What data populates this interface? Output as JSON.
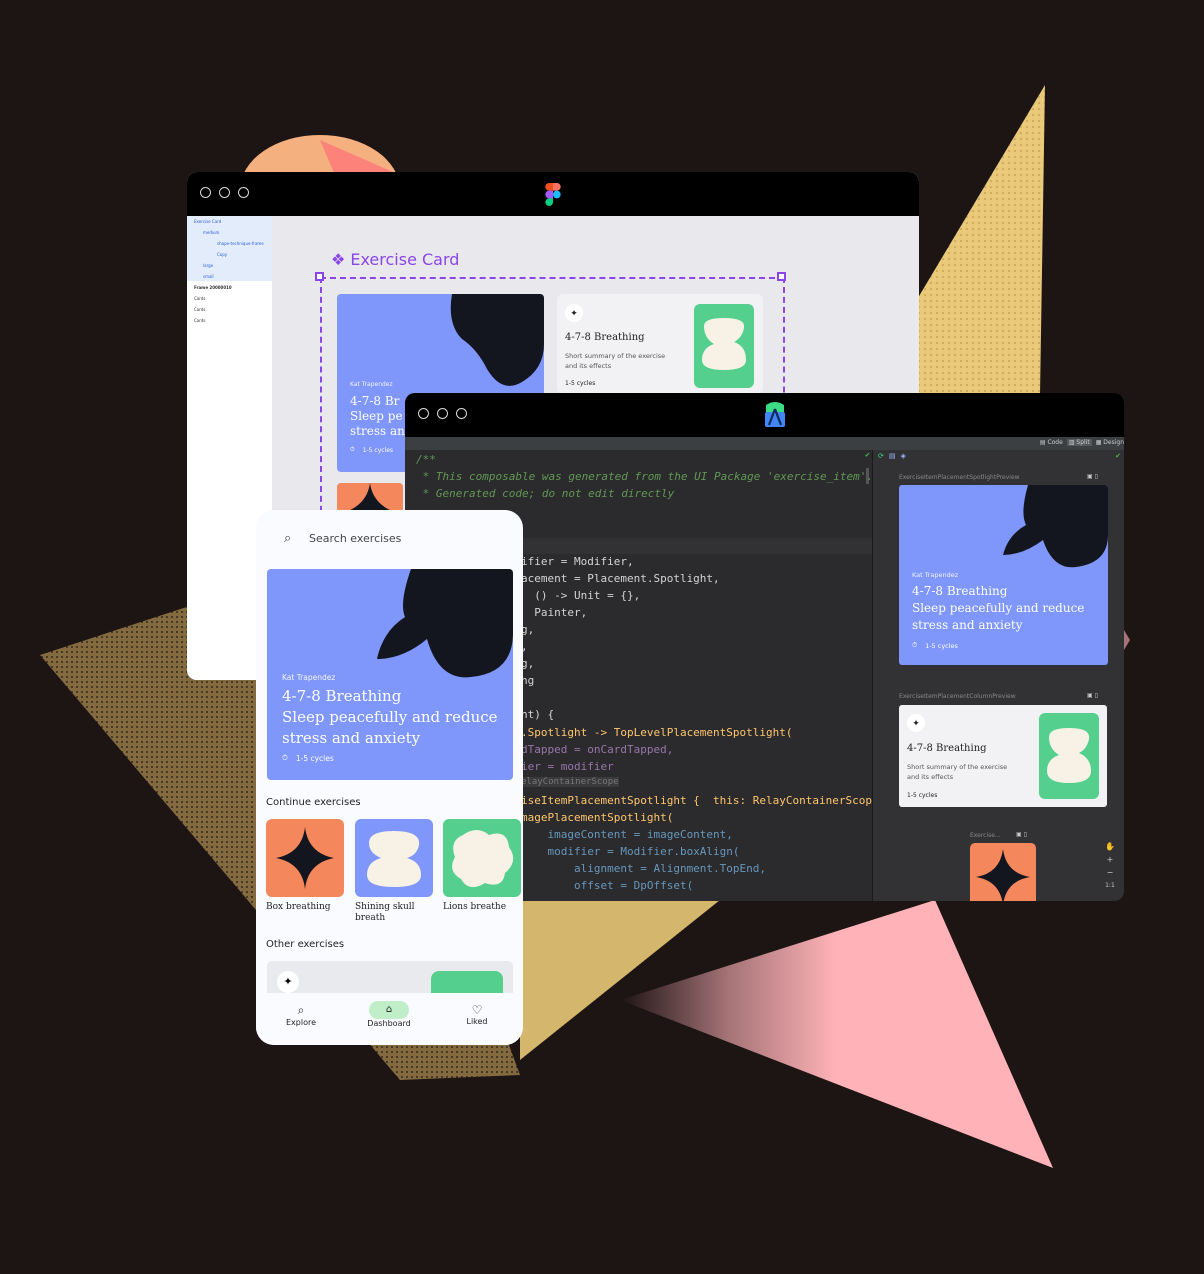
{
  "colors": {
    "background": "#1d1414",
    "figma_accent": "#8a46e6",
    "card_blue": "#7f96fb",
    "card_green": "#55cf8e",
    "card_orange": "#f5875c",
    "blob_dark": "#14161f",
    "shape_cream": "#f7f2e5",
    "triangle_yellow": "#e9c877",
    "triangle_pink": "#ffb3b8"
  },
  "figma": {
    "icon": "figma-logo-icon",
    "layers": [
      "Exercise Card",
      "medium",
      "shape-technique-frame",
      "Copy",
      "large",
      "small",
      "Frame 20000010",
      "Cards",
      "Cards",
      "Cards"
    ],
    "component_title": "Exercise Card",
    "spotlight_card": {
      "author": "Kat Trapendez",
      "title_line1": "4-7-8 Br",
      "title_line2": "Sleep pe",
      "title_line3": "stress an",
      "cycles": "1-5 cycles"
    },
    "column_card": {
      "title": "4-7-8 Breathing",
      "summary_line1": "Short summary of the exercise",
      "summary_line2": "and its effects",
      "cycles": "1-5 cycles"
    }
  },
  "studio": {
    "icon": "android-studio-icon",
    "view_modes": {
      "code": "Code",
      "split": "Split",
      "design": "Design"
    },
    "code_lines": [
      "/**",
      " * This composable was generated from the UI Package 'exercise_item'.",
      " * Generated code; do not edit directly",
      "ifier = Modifier,",
      "acement = Placement.Spotlight,",
      "  () -> Unit = {},",
      "  Painter,",
      "g,",
      ",",
      "g,",
      "ng",
      "nt) {",
      ".Spotlight -> TopLevelPlacementSpotlight(",
      "dTapped = onCardTapped,",
      "ier = modifier",
      "elayContainerScope",
      "iseItemPlacementSpotlight {  this: RelayContainerScope",
      "magePlacementSpotlight(",
      "    imageContent = imageContent,",
      "    modifier = Modifier.boxAlign(",
      "        alignment = Alignment.TopEnd,",
      "        offset = DpOffset("
    ],
    "preview1_label": "ExerciseItemPlacementSpotlightPreview",
    "preview2_label": "ExerciseItemPlacementColumnPreview",
    "preview3_label": "Exercise...",
    "spotlight_card": {
      "author": "Kat Trapendez",
      "title_line1": "4-7-8 Breathing",
      "title_line2": "Sleep peacefully and reduce",
      "title_line3": "stress and anxiety",
      "cycles": "1-5 cycles"
    },
    "column_card": {
      "title": "4-7-8 Breathing",
      "summary_line1": "Short summary of the exercise",
      "summary_line2": "and its effects",
      "cycles": "1-5 cycles"
    },
    "zoom_ratio": "1:1"
  },
  "phone": {
    "search_placeholder": "Search exercises",
    "spotlight_card": {
      "author": "Kat Trapendez",
      "title_line1": "4-7-8 Breathing",
      "title_line2": "Sleep peacefully and reduce",
      "title_line3": "stress and anxiety",
      "cycles": "1-5 cycles"
    },
    "continue_heading": "Continue exercises",
    "continue_items": [
      {
        "label_line1": "Box breathing",
        "label_line2": ""
      },
      {
        "label_line1": "Shining skull",
        "label_line2": "breath"
      },
      {
        "label_line1": "Lions breathe",
        "label_line2": ""
      }
    ],
    "other_heading": "Other exercises",
    "nav": {
      "explore": "Explore",
      "dashboard": "Dashboard",
      "liked": "Liked"
    }
  }
}
